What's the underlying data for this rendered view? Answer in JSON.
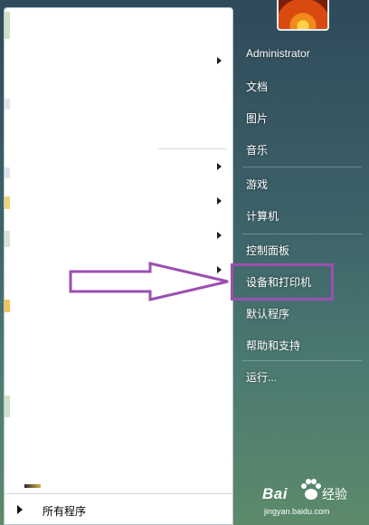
{
  "start_menu": {
    "user_name": "Administrator",
    "right_items": [
      {
        "label": "文档"
      },
      {
        "label": "图片"
      },
      {
        "label": "音乐"
      },
      {
        "label": "游戏"
      },
      {
        "label": "计算机"
      },
      {
        "label": "控制面板"
      },
      {
        "label": "设备和打印机"
      },
      {
        "label": "默认程序"
      },
      {
        "label": "帮助和支持"
      },
      {
        "label": "运行..."
      }
    ],
    "all_programs_label": "所有程序",
    "highlighted_item": "设备和打印机"
  },
  "annotation": {
    "arrow_color": "#9b4fb0",
    "box_color": "#9b4fb0"
  },
  "watermark": {
    "logo": "Bai",
    "brand": "经验",
    "url": "jingyan.baidu.com"
  }
}
